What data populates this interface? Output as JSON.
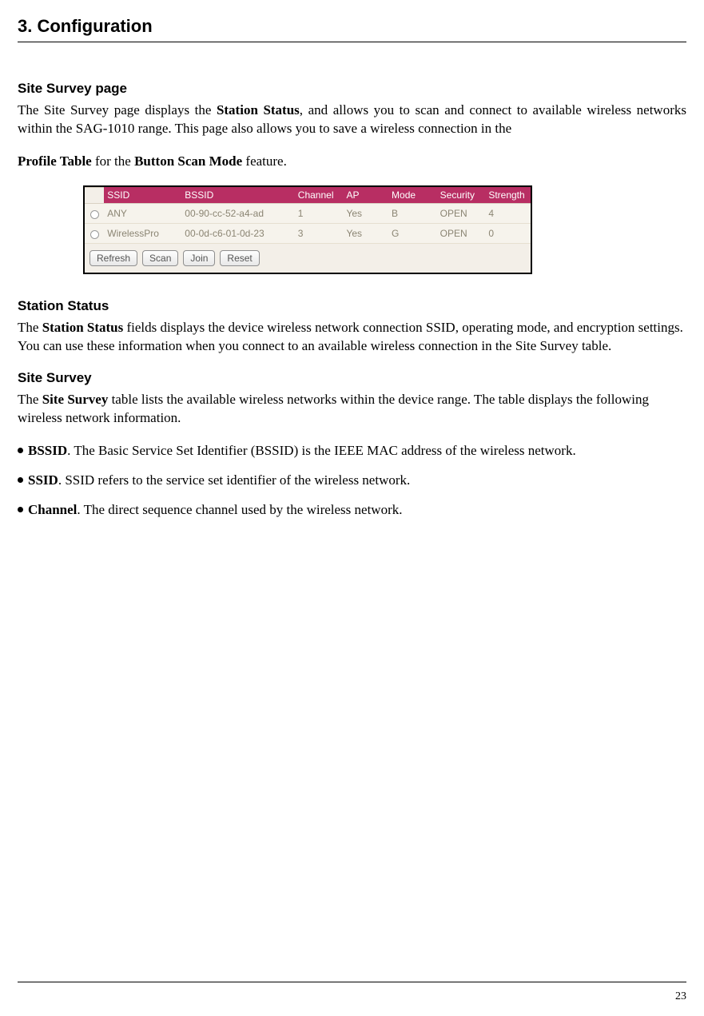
{
  "chapter": "3. Configuration",
  "s1": {
    "title": "Site Survey page",
    "p1a": "The Site Survey page displays the ",
    "p1b": "Station Status",
    "p1c": ", and allows you to scan and connect to available wireless networks within the SAG-1010 range. This page also allows you to save a wireless connection in the",
    "p2a": "Profile Table",
    "p2b": " for the ",
    "p2c": "Button Scan Mode",
    "p2d": " feature."
  },
  "shot": {
    "headers": {
      "ssid": "SSID",
      "bssid": "BSSID",
      "channel": "Channel",
      "ap": "AP",
      "mode": "Mode",
      "security": "Security",
      "strength": "Strength"
    },
    "rows": [
      {
        "ssid": "ANY",
        "bssid": "00-90-cc-52-a4-ad",
        "channel": "1",
        "ap": "Yes",
        "mode": "B",
        "security": "OPEN",
        "strength": "4"
      },
      {
        "ssid": "WirelessPro",
        "bssid": "00-0d-c6-01-0d-23",
        "channel": "3",
        "ap": "Yes",
        "mode": "G",
        "security": "OPEN",
        "strength": "0"
      }
    ],
    "buttons": {
      "refresh": "Refresh",
      "scan": "Scan",
      "join": "Join",
      "reset": "Reset"
    }
  },
  "s2": {
    "title": "Station Status",
    "p1a": "The ",
    "p1b": "Station Status",
    "p1c": " fields displays the device wireless network connection SSID, operating mode, and encryption settings. You can use these information when you connect to an available wireless connection in the Site Survey table."
  },
  "s3": {
    "title": "Site Survey",
    "p1a": "The ",
    "p1b": "Site Survey",
    "p1c": " table lists the available wireless networks within the device range. The table displays the following wireless network information."
  },
  "bullets": {
    "b1a": "BSSID",
    "b1b": ". The Basic Service Set Identifier (BSSID) is the IEEE MAC address of the wireless network.",
    "b2a": "SSID",
    "b2b": ". SSID refers to the service set identifier of the wireless network.",
    "b3a": "Channel",
    "b3b": ". The direct sequence channel used by the wireless network."
  },
  "page": "23"
}
